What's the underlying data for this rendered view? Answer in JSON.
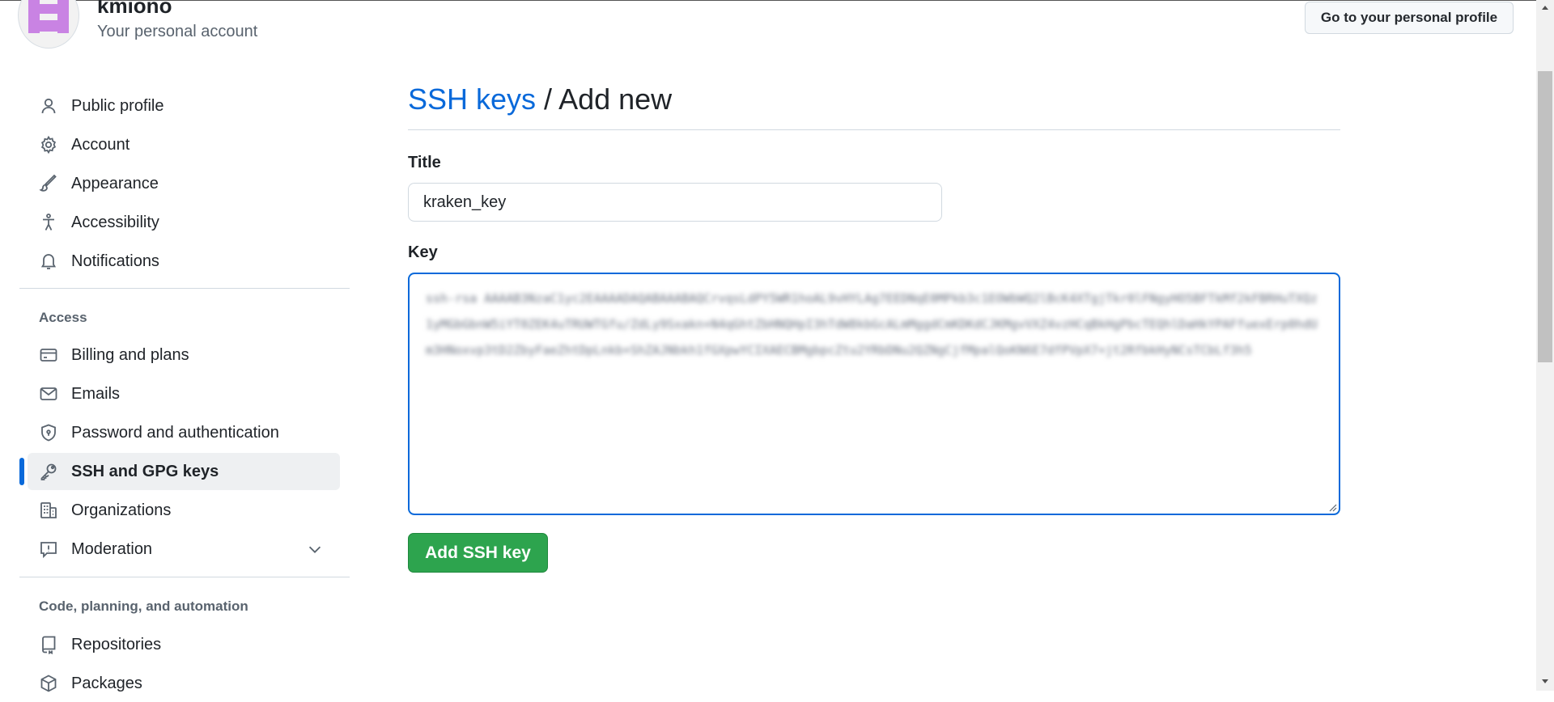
{
  "header": {
    "username": "kmiono",
    "account_type": "Your personal account",
    "profile_button": "Go to your personal profile"
  },
  "sidebar": {
    "items": [
      {
        "label": "Public profile",
        "icon": "person-icon"
      },
      {
        "label": "Account",
        "icon": "gear-icon"
      },
      {
        "label": "Appearance",
        "icon": "paintbrush-icon"
      },
      {
        "label": "Accessibility",
        "icon": "accessibility-icon"
      },
      {
        "label": "Notifications",
        "icon": "bell-icon"
      }
    ],
    "access_heading": "Access",
    "access_items": [
      {
        "label": "Billing and plans",
        "icon": "credit-card-icon"
      },
      {
        "label": "Emails",
        "icon": "mail-icon"
      },
      {
        "label": "Password and authentication",
        "icon": "shield-lock-icon"
      },
      {
        "label": "SSH and GPG keys",
        "icon": "key-icon",
        "active": true
      },
      {
        "label": "Organizations",
        "icon": "organization-icon"
      },
      {
        "label": "Moderation",
        "icon": "report-icon"
      }
    ],
    "code_heading": "Code, planning, and automation",
    "code_items": [
      {
        "label": "Repositories",
        "icon": "repo-icon"
      },
      {
        "label": "Packages",
        "icon": "package-icon"
      }
    ]
  },
  "main": {
    "breadcrumb_link": "SSH keys",
    "breadcrumb_separator": " / ",
    "breadcrumb_current": "Add new",
    "title_label": "Title",
    "title_value": "kraken_key",
    "key_label": "Key",
    "key_value": "ssh-rsa AAAAB3NzaC1yc2EAAAADAQABAAABAQCrvqsLdPY5WR1hoAL9vHYLAg7EEDNqE0MPkb3c1EOWbWQ2lBcK4XTgjTkr0lFNgyHO5BFTkMf2kFBRHuTXQz1yMGbGbnW5iYT0ZEK4uTRUWTGfu/ZdLy9Sxakn+N4qGhtZbHNQHpI3hTdW8kbGcALmMggdCmKDKdCJKMgvVXZ4vzHCqBkHgPbcTEQhlDaHkYPAFfuexErp0hdUm3HNoxvp3tD2ZbyFaeZhtDpLnkb+ShZAJNbkh1fGXpwYCIXAECBMgbpcZtu2YRbDNu2QZNgCjfMpalQoKN6E7dfPVpX7+jt2RfbkHyNCsTCbLf3h5",
    "submit_label": "Add SSH key"
  },
  "colors": {
    "accent": "#0969da",
    "success": "#2da44e",
    "border": "#d1d9e0",
    "muted_text": "#59636e"
  }
}
